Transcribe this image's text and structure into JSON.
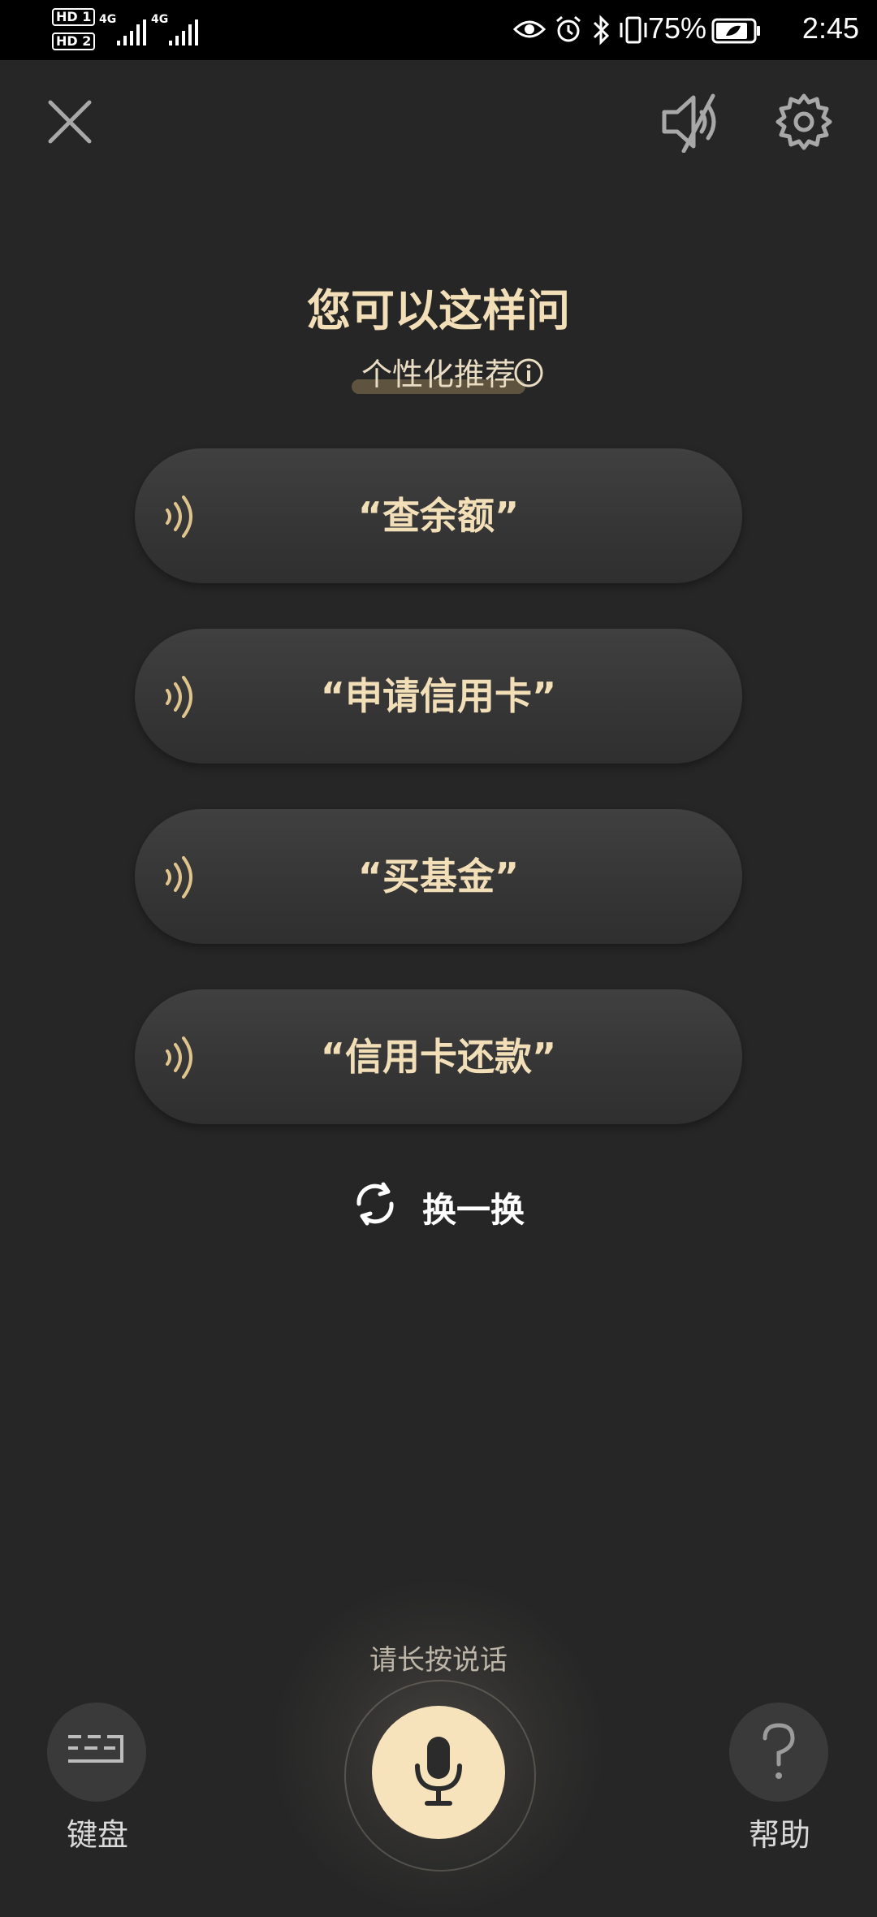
{
  "status_bar": {
    "sim1": "HD 1",
    "sim2": "HD 2",
    "net1": "4G",
    "net2": "4G",
    "battery_percent": "75%",
    "time": "2:45"
  },
  "header": {
    "close": "close",
    "mute": "speaker-muted",
    "settings": "settings"
  },
  "main": {
    "title": "您可以这样问",
    "subtitle": "个性化推荐",
    "suggestions": [
      {
        "label": "“查余额”"
      },
      {
        "label": "“申请信用卡”"
      },
      {
        "label": "“买基金”"
      },
      {
        "label": "“信用卡还款”"
      }
    ],
    "refresh_label": "换一换"
  },
  "footer": {
    "hint": "请长按说话",
    "keyboard_label": "键盘",
    "help_label": "帮助"
  },
  "colors": {
    "background": "#262626",
    "accent": "#f2dfb8",
    "mic_fill": "#f6e3bb",
    "card": "#3a3a3a"
  }
}
